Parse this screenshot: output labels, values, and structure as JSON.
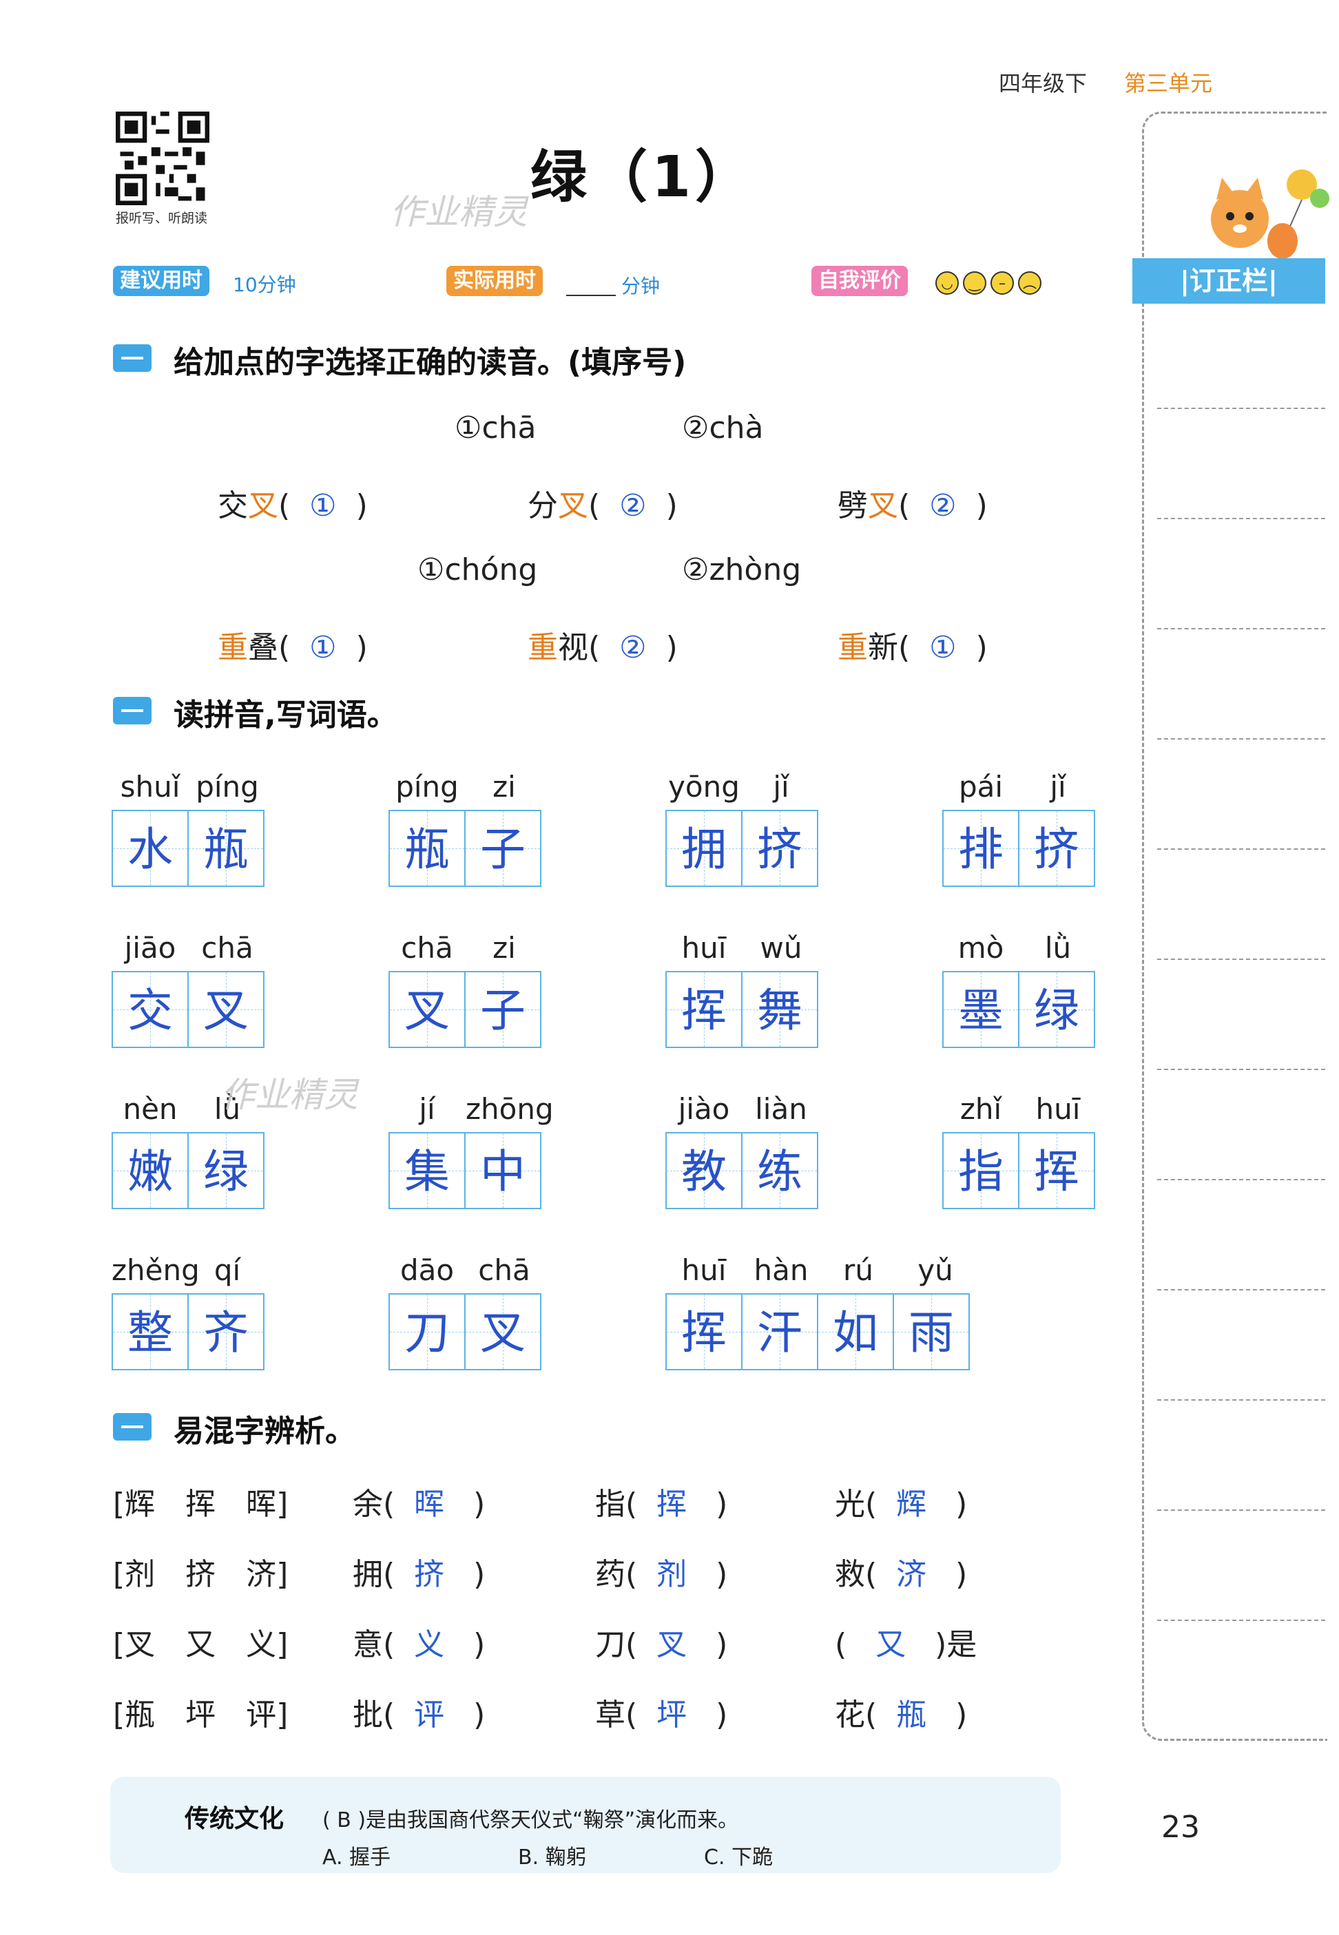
{
  "header": {
    "grade": "四年级下",
    "unit": "第三单元"
  },
  "qr_caption": "报听写、听朗读",
  "title": "绿（1）",
  "watermark": "作业精灵",
  "time": {
    "suggest_label": "建议用时",
    "suggest_value": "10分钟",
    "actual_label": "实际用时",
    "actual_unit": "分钟",
    "self_label": "自我评价"
  },
  "side": {
    "tab": "|订正栏|"
  },
  "section1": {
    "title": "给加点的字选择正确的读音。(填序号)",
    "opts_a": [
      "①chā",
      "②chà"
    ],
    "items_a": [
      {
        "pre": "交",
        "ch": "叉",
        "ans": "①"
      },
      {
        "pre": "分",
        "ch": "叉",
        "ans": "②"
      },
      {
        "pre": "劈",
        "ch": "叉",
        "ans": "②"
      }
    ],
    "opts_b": [
      "①chóng",
      "②zhòng"
    ],
    "items_b": [
      {
        "ch": "重",
        "post": "叠",
        "ans": "①"
      },
      {
        "ch": "重",
        "post": "视",
        "ans": "②"
      },
      {
        "ch": "重",
        "post": "新",
        "ans": "①"
      }
    ]
  },
  "section2": {
    "title": "读拼音,写词语。",
    "words": [
      {
        "py": [
          "shuǐ",
          "píng"
        ],
        "chars": [
          "水",
          "瓶"
        ]
      },
      {
        "py": [
          "píng",
          "zi"
        ],
        "chars": [
          "瓶",
          "子"
        ]
      },
      {
        "py": [
          "yōng",
          "jǐ"
        ],
        "chars": [
          "拥",
          "挤"
        ]
      },
      {
        "py": [
          "pái",
          "jǐ"
        ],
        "chars": [
          "排",
          "挤"
        ]
      },
      {
        "py": [
          "jiāo",
          "chā"
        ],
        "chars": [
          "交",
          "叉"
        ]
      },
      {
        "py": [
          "chā",
          "zi"
        ],
        "chars": [
          "叉",
          "子"
        ]
      },
      {
        "py": [
          "huī",
          "wǔ"
        ],
        "chars": [
          "挥",
          "舞"
        ]
      },
      {
        "py": [
          "mò",
          "lǜ"
        ],
        "chars": [
          "墨",
          "绿"
        ]
      },
      {
        "py": [
          "nèn",
          "lǜ"
        ],
        "chars": [
          "嫩",
          "绿"
        ]
      },
      {
        "py": [
          "jí",
          "zhōng"
        ],
        "chars": [
          "集",
          "中"
        ]
      },
      {
        "py": [
          "jiào",
          "liàn"
        ],
        "chars": [
          "教",
          "练"
        ]
      },
      {
        "py": [
          "zhǐ",
          "huī"
        ],
        "chars": [
          "指",
          "挥"
        ]
      },
      {
        "py": [
          "zhěng",
          "qí"
        ],
        "chars": [
          "整",
          "齐"
        ]
      },
      {
        "py": [
          "dāo",
          "chā"
        ],
        "chars": [
          "刀",
          "叉"
        ]
      },
      {
        "py": [
          "huī",
          "hàn",
          "rú",
          "yǔ"
        ],
        "chars": [
          "挥",
          "汗",
          "如",
          "雨"
        ]
      }
    ]
  },
  "section3": {
    "title": "易混字辨析。",
    "rows": [
      {
        "group": "[辉　挥　晖]",
        "items": [
          {
            "pre": "余(",
            "ans": "晖",
            "post": ")"
          },
          {
            "pre": "指(",
            "ans": "挥",
            "post": ")"
          },
          {
            "pre": "光(",
            "ans": "辉",
            "post": ")"
          }
        ]
      },
      {
        "group": "[剂　挤　济]",
        "items": [
          {
            "pre": "拥(",
            "ans": "挤",
            "post": ")"
          },
          {
            "pre": "药(",
            "ans": "剂",
            "post": ")"
          },
          {
            "pre": "救(",
            "ans": "济",
            "post": ")"
          }
        ]
      },
      {
        "group": "[叉　又　义]",
        "items": [
          {
            "pre": "意(",
            "ans": "义",
            "post": ")"
          },
          {
            "pre": "刀(",
            "ans": "叉",
            "post": ")"
          },
          {
            "pre": "(",
            "ans": "又",
            "post": ")是"
          }
        ]
      },
      {
        "group": "[瓶　坪　评]",
        "items": [
          {
            "pre": "批(",
            "ans": "评",
            "post": ")"
          },
          {
            "pre": "草(",
            "ans": "坪",
            "post": ")"
          },
          {
            "pre": "花(",
            "ans": "瓶",
            "post": ")"
          }
        ]
      }
    ]
  },
  "footer": {
    "title": "传统文化",
    "question": "( B )是由我国商代祭天仪式“鞠祭”演化而来。",
    "options": [
      "A. 握手",
      "B. 鞠躬",
      "C. 下跪"
    ]
  },
  "page_number": "23"
}
